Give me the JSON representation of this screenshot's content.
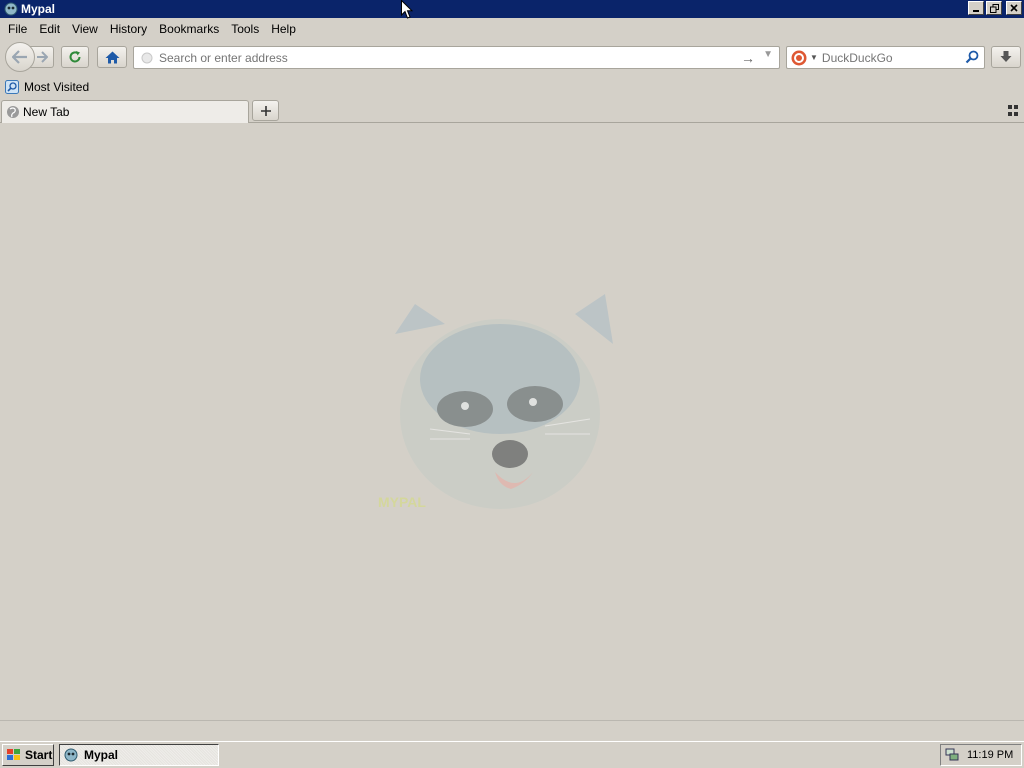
{
  "window": {
    "title": "Mypal"
  },
  "menu": [
    "File",
    "Edit",
    "View",
    "History",
    "Bookmarks",
    "Tools",
    "Help"
  ],
  "navbar": {
    "url_placeholder": "Search or enter address",
    "search_placeholder": "DuckDuckGo"
  },
  "bookmarks": {
    "items": [
      "Most Visited"
    ]
  },
  "tabs": [
    {
      "label": "New Tab"
    }
  ],
  "taskbar": {
    "start_label": "Start",
    "task_label": "Mypal",
    "clock": "11:19 PM"
  },
  "icons": {
    "back": "back-arrow-icon",
    "forward": "forward-arrow-icon",
    "reload": "reload-icon",
    "home": "home-icon",
    "download": "download-icon",
    "search": "magnifier-icon",
    "engine": "duckduckgo-icon"
  },
  "colors": {
    "titlebar": "#0a246a",
    "background": "#d4d0c8",
    "accent": "#1e5aa8"
  }
}
